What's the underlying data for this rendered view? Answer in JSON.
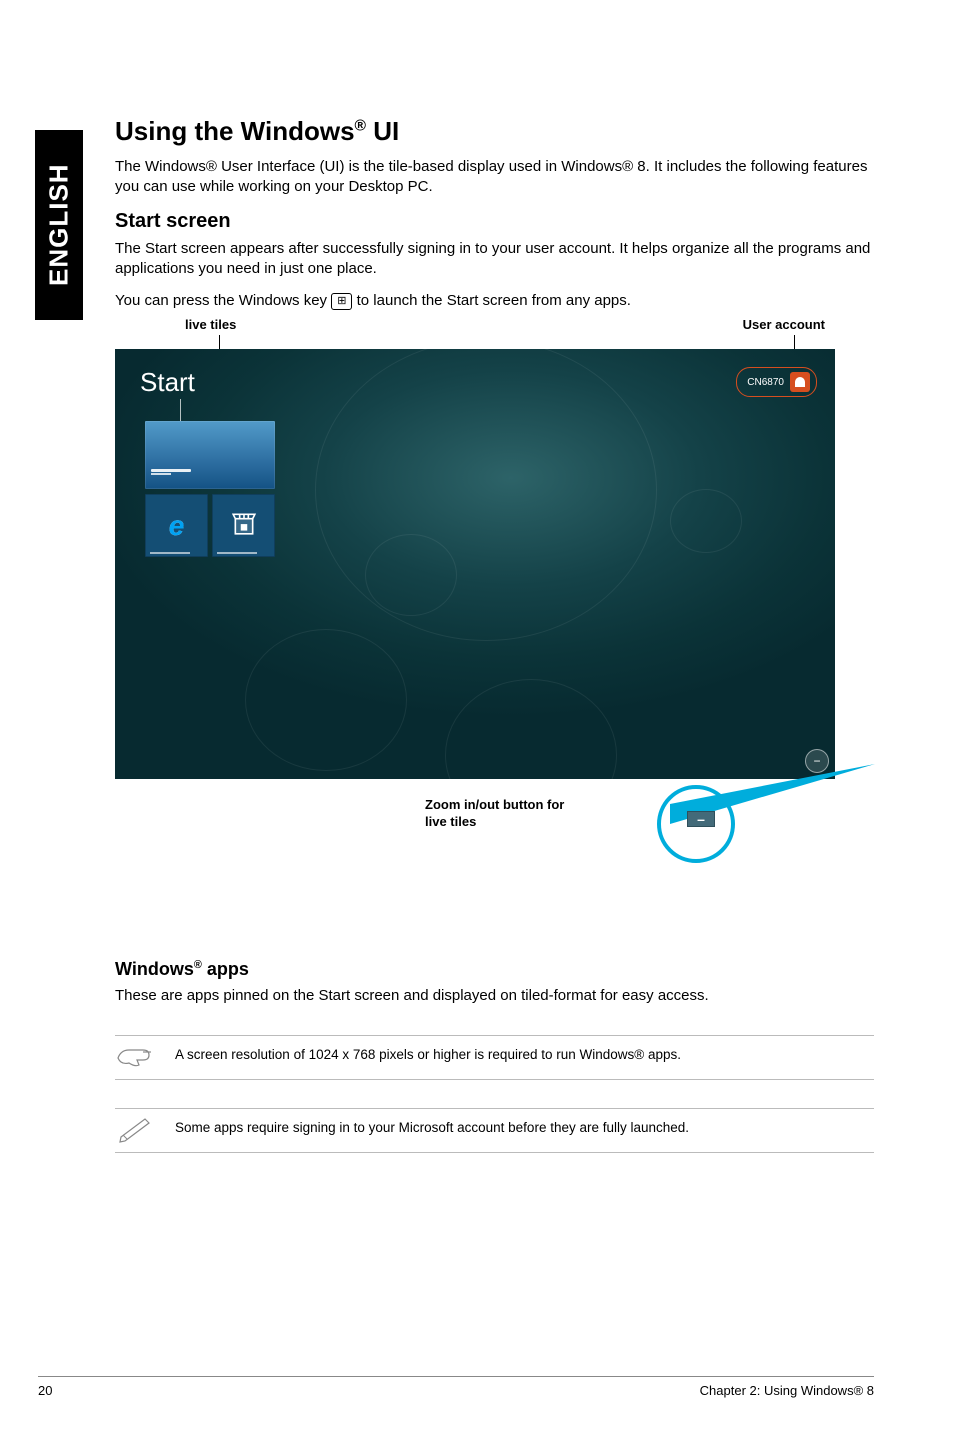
{
  "sidebar": {
    "language": "ENGLISH"
  },
  "h1": {
    "pre": "Using the Windows",
    "sup": "®",
    "post": " UI"
  },
  "p1": "The Windows® User Interface (UI) is the tile-based display used in Windows® 8. It includes the following features you can use while working on your Desktop PC.",
  "h2": "Start screen",
  "p2": "The Start screen appears after  successfully signing in to your user account. It helps organize all the programs and applications you need in just one place.",
  "p3_pre": "You can press the Windows key ",
  "p3_post": " to launch the Start screen from any apps.",
  "winkey_glyph": "⊞",
  "fig": {
    "label_live": "live tiles",
    "label_user": "User account",
    "start": "Start",
    "user_name": "CN6870",
    "zoom_callout_l1": "Zoom in/out button for",
    "zoom_callout_l2": "live tiles",
    "minus": "–"
  },
  "h3": {
    "pre": "Windows",
    "sup": "®",
    "post": " apps"
  },
  "p4": "These are apps pinned on the Start screen and displayed on tiled-format for easy access.",
  "note1": "A screen resolution of 1024 x 768 pixels or higher is required to run Windows® apps.",
  "note2": "Some apps require signing in to your Microsoft account before they are fully launched.",
  "footer": {
    "page": "20",
    "chapter": "Chapter 2: Using Windows® 8"
  }
}
